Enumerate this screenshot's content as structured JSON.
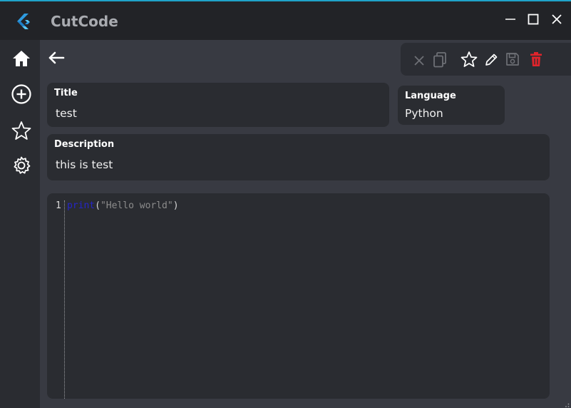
{
  "app": {
    "title": "CutCode"
  },
  "snippet": {
    "title_label": "Title",
    "title_value": "test",
    "language_label": "Language",
    "language_value": "Python",
    "description_label": "Description",
    "description_value": "this is test"
  },
  "editor": {
    "line_number": "1",
    "code_keyword": "print",
    "code_open": "(",
    "code_string": "\"Hello world\"",
    "code_close": ")"
  },
  "colors": {
    "accent": "#1fa3c9",
    "delete": "#e0242b",
    "keyword": "#2525c8"
  },
  "icons": {
    "sidebar": [
      "home-icon",
      "add-circle-icon",
      "star-icon",
      "gear-icon"
    ],
    "toolbar": [
      "close-icon",
      "copy-icon",
      "star-icon",
      "edit-icon",
      "save-icon",
      "trash-icon"
    ]
  }
}
